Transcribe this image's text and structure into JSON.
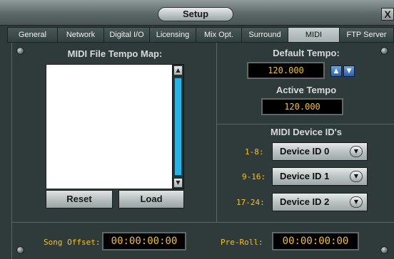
{
  "window": {
    "title": "Setup",
    "close_glyph": "X"
  },
  "tabs": [
    {
      "label": "General",
      "active": false
    },
    {
      "label": "Network",
      "active": false
    },
    {
      "label": "Digital I/O",
      "active": false
    },
    {
      "label": "Licensing",
      "active": false
    },
    {
      "label": "Mix Opt.",
      "active": false
    },
    {
      "label": "Surround",
      "active": false
    },
    {
      "label": "MIDI",
      "active": true
    },
    {
      "label": "FTP Server",
      "active": false
    }
  ],
  "tempo_map": {
    "title": "MIDI File Tempo Map:",
    "items": [],
    "reset_label": "Reset",
    "load_label": "Load"
  },
  "default_tempo": {
    "title": "Default Tempo:",
    "value": "120.000"
  },
  "active_tempo": {
    "title": "Active Tempo",
    "value": "120.000"
  },
  "device_ids": {
    "title": "MIDI Device ID's",
    "rows": [
      {
        "range": "1-8:",
        "value": "Device ID 0"
      },
      {
        "range": "9-16:",
        "value": "Device ID 1"
      },
      {
        "range": "17-24:",
        "value": "Device ID 2"
      }
    ]
  },
  "song_offset": {
    "label": "Song Offset:",
    "value": "00:00:00:00"
  },
  "pre_roll": {
    "label": "Pre-Roll:",
    "value": "00:00:00:00"
  },
  "colors": {
    "lcd_text": "#f5c020",
    "scrollbar_thumb": "#22b5e6",
    "panel_bg": "#2f3a3a"
  },
  "icons": {
    "spin_up": "up-arrow-icon",
    "spin_down": "down-arrow-icon",
    "dropdown": "chevron-down-icon"
  }
}
